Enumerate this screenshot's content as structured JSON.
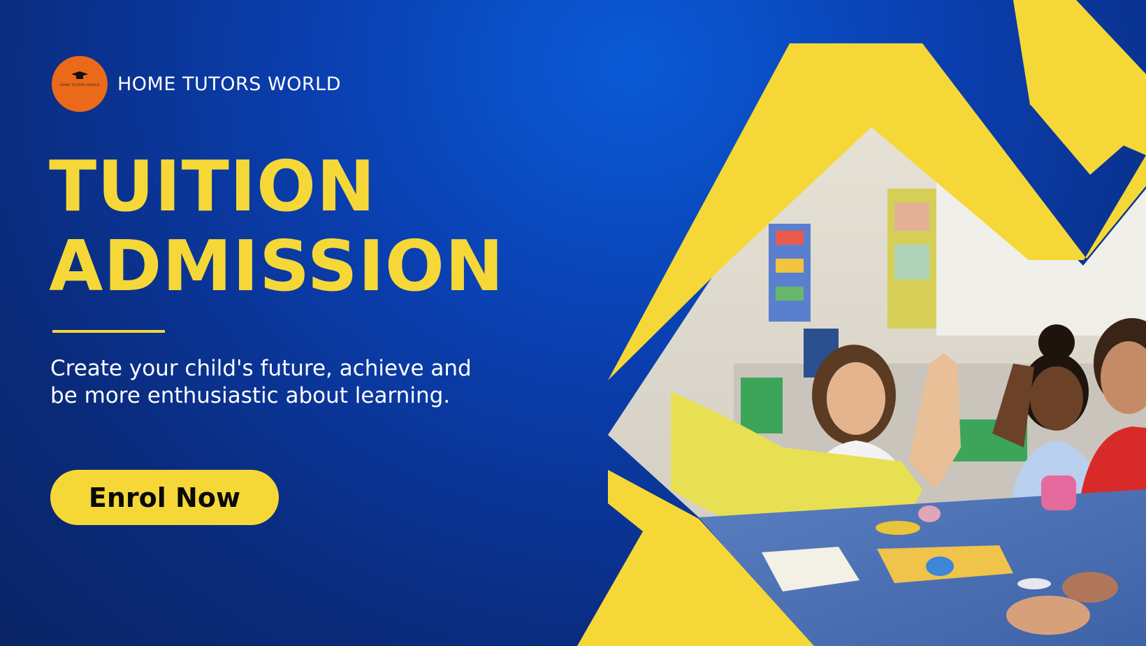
{
  "brand": {
    "name": "HOME TUTORS WORLD",
    "logo_text": "HOME TUTORS WORLD",
    "logo_color": "#ea6a1a"
  },
  "headline": {
    "line1": "TUITION",
    "line2": "ADMISSION"
  },
  "subtext": {
    "line1": "Create your child's future, achieve and",
    "line2": "be more enthusiastic about learning."
  },
  "cta": {
    "label": "Enrol Now"
  },
  "colors": {
    "accent": "#f5d838",
    "background": "#0a3fb0",
    "text": "#ffffff"
  },
  "photo": {
    "subject": "children in a classroom giving a high five at a table"
  }
}
